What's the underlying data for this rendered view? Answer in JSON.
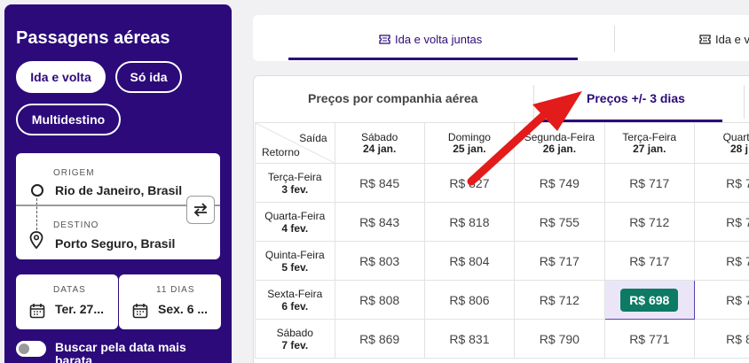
{
  "panel": {
    "title": "Passagens aéreas",
    "trip_types": [
      "Ida e volta",
      "Só ida",
      "Multidestino"
    ],
    "origin_label": "ORIGEM",
    "origin_value": "Rio de Janeiro, Brasil",
    "dest_label": "DESTINO",
    "dest_value": "Porto Seguro, Brasil",
    "dates_label": "DATAS",
    "dates_value": "Ter. 27...",
    "days_label": "11 DIAS",
    "days_value": "Sex. 6 ...",
    "flex_label": "Buscar pela data mais barata"
  },
  "top_tabs": [
    "Ida e volta juntas",
    "Ida e v"
  ],
  "sub_tabs": [
    "Preços por companhia aérea",
    "Preços +/- 3 dias"
  ],
  "table": {
    "corner_top": "Saída",
    "corner_bottom": "Retorno",
    "columns": [
      {
        "day": "Sábado",
        "date": "24 jan."
      },
      {
        "day": "Domingo",
        "date": "25 jan."
      },
      {
        "day": "Segunda-Feira",
        "date": "26 jan."
      },
      {
        "day": "Terça-Feira",
        "date": "27 jan."
      },
      {
        "day": "Quarta",
        "date": "28 j"
      }
    ],
    "rows": [
      {
        "day": "Terça-Feira",
        "date": "3 fev.",
        "prices": [
          "R$ 845",
          "R$ 827",
          "R$ 749",
          "R$ 717",
          "R$ 7"
        ]
      },
      {
        "day": "Quarta-Feira",
        "date": "4 fev.",
        "prices": [
          "R$ 843",
          "R$ 818",
          "R$ 755",
          "R$ 712",
          "R$ 7"
        ]
      },
      {
        "day": "Quinta-Feira",
        "date": "5 fev.",
        "prices": [
          "R$ 803",
          "R$ 804",
          "R$ 717",
          "R$ 717",
          "R$ 7"
        ]
      },
      {
        "day": "Sexta-Feira",
        "date": "6 fev.",
        "prices": [
          "R$ 808",
          "R$ 806",
          "R$ 712",
          "R$ 698",
          "R$ 7"
        ]
      },
      {
        "day": "Sábado",
        "date": "7 fev.",
        "prices": [
          "R$ 869",
          "R$ 831",
          "R$ 790",
          "R$ 771",
          "R$ 8"
        ]
      }
    ]
  },
  "colors": {
    "brand": "#2c0a7a",
    "best_price": "#0d7a64",
    "arrow": "#e31b1b"
  }
}
